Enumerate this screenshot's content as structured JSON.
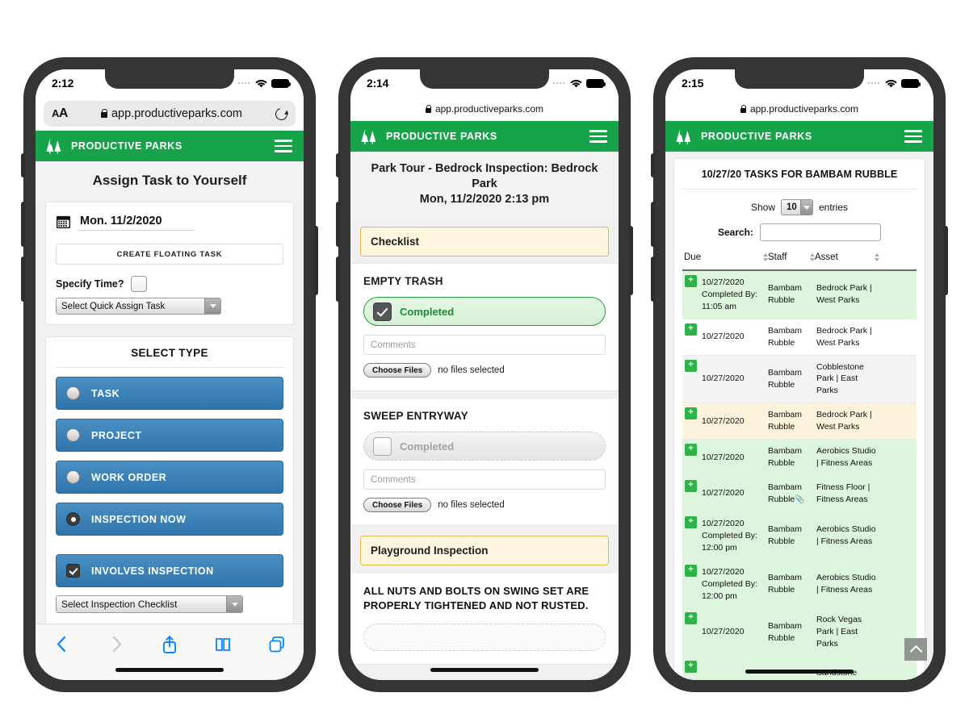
{
  "browser": {
    "url": "app.productiveparks.com",
    "aa_label": "AA",
    "lock_icon": "lock-icon",
    "reload_icon": "reload-icon"
  },
  "brand": {
    "name": "PRODUCTIVE PARKS",
    "logo_icon": "trees-logo-icon",
    "menu_icon": "hamburger-menu-icon",
    "green": "#17a34a"
  },
  "phone1": {
    "status_time": "2:12",
    "page_title": "Assign Task to Yourself",
    "date_icon": "calendar-icon",
    "date_value": "Mon. 11/2/2020",
    "floating_task_button": "CREATE FLOATING TASK",
    "specify_time_label": "Specify Time?",
    "quick_assign_value": "Select Quick Assign Task",
    "select_type_heading": "SELECT TYPE",
    "types": [
      {
        "label": "TASK",
        "control": "radio",
        "selected": false
      },
      {
        "label": "PROJECT",
        "control": "radio",
        "selected": false
      },
      {
        "label": "WORK ORDER",
        "control": "radio",
        "selected": false
      },
      {
        "label": "INSPECTION NOW",
        "control": "radio",
        "selected": true
      },
      {
        "label": "INVOLVES INSPECTION",
        "control": "checkbox",
        "selected": true
      }
    ],
    "inspection_checklist_value": "Select Inspection Checklist",
    "toolbar": {
      "back": "back-icon",
      "forward": "forward-icon",
      "share": "share-icon",
      "bookmarks": "bookmarks-icon",
      "tabs": "tabs-icon"
    }
  },
  "phone2": {
    "status_time": "2:14",
    "page_title_line1": "Park Tour - Bedrock Inspection: Bedrock Park",
    "page_title_line2": "Mon, 11/2/2020 2:13 pm",
    "section_checklist": "Checklist",
    "tasks": [
      {
        "name": "EMPTY TRASH",
        "completed_label": "Completed",
        "completed": true,
        "comments_placeholder": "Comments",
        "choose_files": "Choose Files",
        "files_status": "no files selected"
      },
      {
        "name": "SWEEP ENTRYWAY",
        "completed_label": "Completed",
        "completed": false,
        "comments_placeholder": "Comments",
        "choose_files": "Choose Files",
        "files_status": "no files selected"
      }
    ],
    "section_playground": "Playground Inspection",
    "inspection_item": "ALL NUTS AND BOLTS ON SWING SET ARE PROPERLY TIGHTENED AND NOT RUSTED."
  },
  "phone3": {
    "status_time": "2:15",
    "table_title": "10/27/20 TASKS FOR BAMBAM RUBBLE",
    "show_label": "Show",
    "show_value": "10",
    "entries_label": "entries",
    "search_label": "Search:",
    "search_value": "",
    "columns": [
      "Due",
      "Staff",
      "Asset"
    ],
    "rows": [
      {
        "expand": "+",
        "due": "10/27/2020",
        "completed_by": "Completed By: 11:05 am",
        "staff": "Bambam Rubble",
        "asset": "Bedrock Park | West Parks",
        "attachment": false,
        "color": "green"
      },
      {
        "expand": "+",
        "due": "10/27/2020",
        "completed_by": "",
        "staff": "Bambam Rubble",
        "asset": "Bedrock Park | West Parks",
        "attachment": false,
        "color": "white"
      },
      {
        "expand": "+",
        "due": "10/27/2020",
        "completed_by": "",
        "staff": "Bambam Rubble",
        "asset": "Cobblestone Park | East Parks",
        "attachment": false,
        "color": "gray"
      },
      {
        "expand": "+",
        "due": "10/27/2020",
        "completed_by": "",
        "staff": "Bambam Rubble",
        "asset": "Bedrock Park | West Parks",
        "attachment": false,
        "color": "yellow"
      },
      {
        "expand": "+",
        "due": "10/27/2020",
        "completed_by": "",
        "staff": "Bambam Rubble",
        "asset": "Aerobics Studio | Fitness Areas",
        "attachment": false,
        "color": "green"
      },
      {
        "expand": "+",
        "due": "10/27/2020",
        "completed_by": "",
        "staff": "Bambam Rubble",
        "asset": "Fitness Floor | Fitness Areas",
        "attachment": true,
        "color": "green"
      },
      {
        "expand": "+",
        "due": "10/27/2020",
        "completed_by": "Completed By: 12:00 pm",
        "staff": "Bambam Rubble",
        "asset": "Aerobics Studio | Fitness Areas",
        "attachment": false,
        "color": "green"
      },
      {
        "expand": "+",
        "due": "10/27/2020",
        "completed_by": "Completed By: 12:00 pm",
        "staff": "Bambam Rubble",
        "asset": "Aerobics Studio | Fitness Areas",
        "attachment": false,
        "color": "green"
      },
      {
        "expand": "+",
        "due": "10/27/2020",
        "completed_by": "",
        "staff": "Bambam Rubble",
        "asset": "Rock Vegas Park | East Parks",
        "attachment": false,
        "color": "green"
      },
      {
        "expand": "+",
        "due": "",
        "completed_by": "",
        "staff": "",
        "asset": "Sandstone",
        "attachment": false,
        "color": "green"
      }
    ],
    "scroll_top_icon": "chevron-up-icon"
  }
}
